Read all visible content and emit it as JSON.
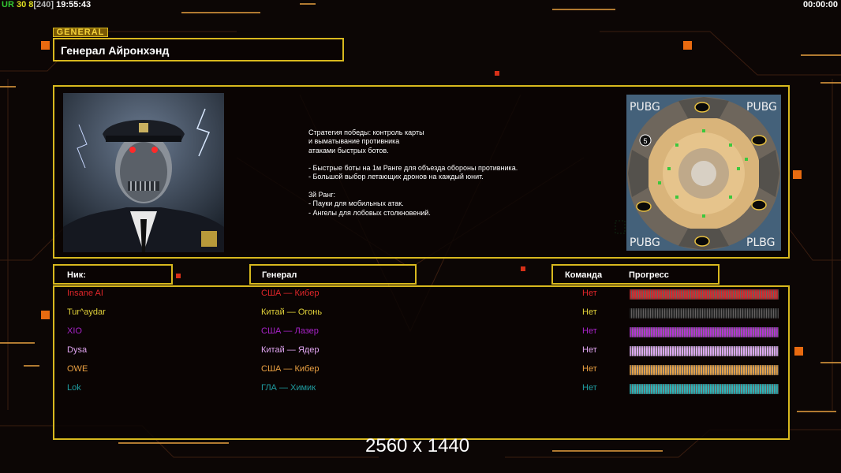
{
  "hud": {
    "ur": "UR",
    "fps": "30",
    "players": "8",
    "bracket": "[240]",
    "clock": "19:55:43",
    "timer": "00:00:00"
  },
  "general": {
    "tag": "GENERAL",
    "title": "Генерал Айронхэнд",
    "description": [
      "Стратегия победы: контроль карты",
      "и выматывание противника",
      "атаками быстрых ботов.",
      "",
      "- Быстрые боты на 1м Ранге для объезда обороны противника.",
      "- Большой выбор летающих дронов на каждый юнит.",
      "",
      "3й Ранг:",
      "- Пауки для мобильных атак.",
      "- Ангелы для лобовых столкновений."
    ]
  },
  "map": {
    "corner_labels": [
      "PUBG",
      "PUBG",
      "PUBG",
      "PLBG"
    ],
    "start_marker": "5"
  },
  "table": {
    "headers": {
      "nick": "Ник:",
      "general": "Генерал",
      "team": "Команда",
      "progress": "Прогресс"
    },
    "rows": [
      {
        "nick": "Insane AI",
        "general": "США — Кибер",
        "team": "Нет",
        "color": "#e0262a",
        "bar": "#d22a2e",
        "progress": 1.0
      },
      {
        "nick": "Tur^aydar",
        "general": "Китай — Огонь",
        "team": "Нет",
        "color": "#e2d23a",
        "bar": "#2a2a2a",
        "progress": 1.0
      },
      {
        "nick": "XIO",
        "general": "США — Лазер",
        "team": "Нет",
        "color": "#a823c8",
        "bar": "#b238d2",
        "progress": 1.0
      },
      {
        "nick": "Dysa",
        "general": "Китай — Ядер",
        "team": "Нет",
        "color": "#e2a6f2",
        "bar": "#dcaaf0",
        "progress": 1.0
      },
      {
        "nick": "OWE",
        "general": "США — Кибер",
        "team": "Нет",
        "color": "#eaa042",
        "bar": "#e6a34a",
        "progress": 1.0
      },
      {
        "nick": "Lok",
        "general": "ГЛА — Химик",
        "team": "Нет",
        "color": "#1f9ea2",
        "bar": "#2fb4b8",
        "progress": 1.0
      }
    ]
  },
  "overlay": {
    "resolution": "2560 x 1440"
  }
}
